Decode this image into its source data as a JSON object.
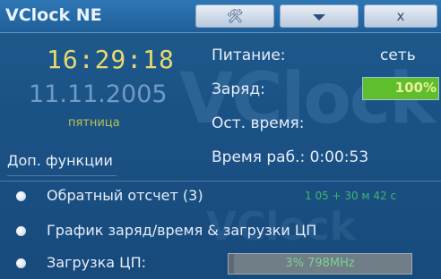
{
  "window": {
    "title": "VClock NE",
    "watermark": "VClock NE",
    "buttons": {
      "settings_icon": "wrench-screwdriver-icon",
      "settings_glyph": "🛠",
      "dropdown_icon": "triangle-down-icon",
      "close_label": "x"
    }
  },
  "clock": {
    "time": "16:29:18",
    "date": "11.11.2005",
    "weekday": "пятница"
  },
  "extra_functions_label": "Доп. функции",
  "battery": {
    "power_label": "Питание:",
    "power_value": "сеть",
    "charge_label": "Заряд:",
    "charge_value": "100%",
    "charge_fraction": 1.0,
    "remaining_label": "Ост. время:",
    "work_time": "Время раб.: 0:00:53"
  },
  "options": [
    {
      "label": "Обратный отсчет (3)",
      "detail": "1 05 + 30 м 42 с"
    },
    {
      "label": "График заряд/время & загрузки ЦП"
    },
    {
      "label": "Загрузка ЦП:",
      "cpu_text": "3% 798MHz",
      "cpu_fraction": 0.03
    }
  ],
  "colors": {
    "background": "#1b5286",
    "time": "#e7d870",
    "date": "#6f9bc5",
    "charge_fill": "#5fbe2c",
    "countdown": "#3fb66a"
  }
}
